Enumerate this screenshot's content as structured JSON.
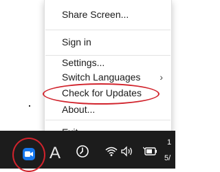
{
  "menu": {
    "items": [
      {
        "label": "Share Screen..."
      },
      {
        "label": "Sign in"
      },
      {
        "label": "Settings..."
      },
      {
        "label": "Switch Languages",
        "has_submenu": true
      },
      {
        "label": "Check for Updates",
        "highlighted": true
      },
      {
        "label": "About..."
      },
      {
        "label": "Exit"
      }
    ],
    "submenu_arrow": "›"
  },
  "taskbar": {
    "tray_letter": "A",
    "clock_line1": "1",
    "clock_line2": "5/"
  },
  "colors": {
    "highlight_ring": "#d1232c",
    "zoom_blue": "#1677ee",
    "taskbar_bg": "#1c1c1c"
  },
  "icons": [
    "video-camera-icon",
    "language-a-icon",
    "focus-clock-icon",
    "wifi-icon",
    "volume-icon",
    "battery-icon"
  ]
}
